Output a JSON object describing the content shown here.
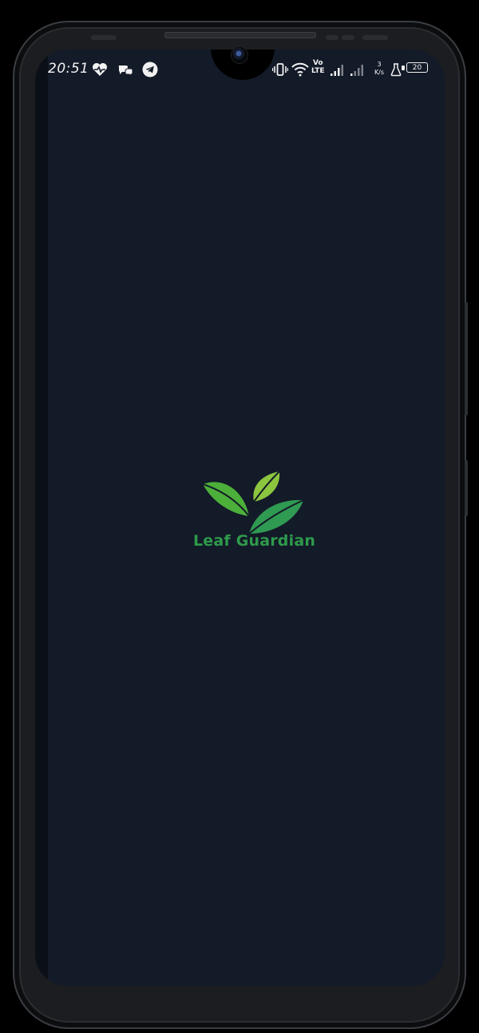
{
  "status_bar": {
    "time": "20:51",
    "volte_top": "Vo",
    "volte_bottom": "LTE",
    "net_speed_value": "3",
    "net_speed_unit": "K/s",
    "battery": "20",
    "icons": [
      "heart-health-icon",
      "chat-bubbles-icon",
      "telegram-icon",
      "vibrate-icon",
      "wifi-icon",
      "signal-icon",
      "signal-icon",
      "flask-icon",
      "battery-icon"
    ]
  },
  "splash": {
    "app_name": "Leaf Guardian",
    "logo_icon": "leaves-icon"
  },
  "colors": {
    "background": "#131a28",
    "brand_green": "#2e9a4b",
    "leaf_light": "#7cc12f",
    "leaf_mid": "#4caf3a",
    "leaf_dark": "#2f9a52"
  }
}
